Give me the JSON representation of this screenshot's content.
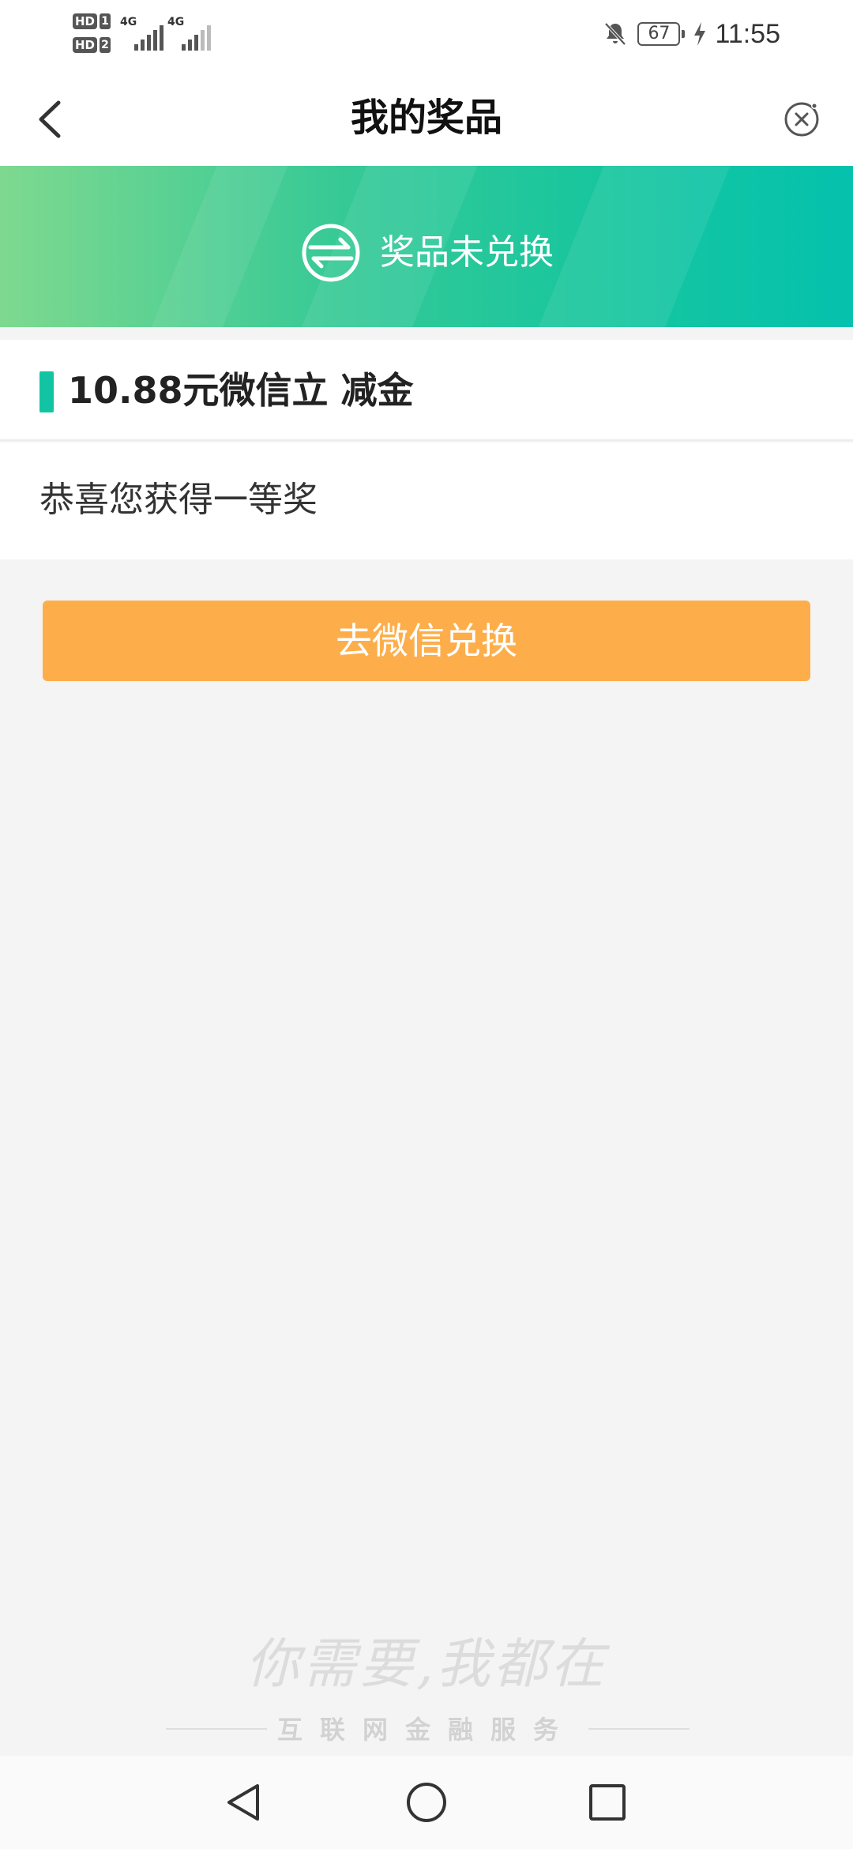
{
  "status_bar": {
    "sim1_label": "HD",
    "sim1_num": "1",
    "sim2_label": "HD",
    "sim2_num": "2",
    "net1": "4G",
    "net2": "4G",
    "battery": "67",
    "time": "11:55"
  },
  "header": {
    "title": "我的奖品",
    "back_icon": "chevron-left-icon",
    "close_icon": "close-circle-icon"
  },
  "banner": {
    "icon": "exchange-icon",
    "status_text": "奖品未兑换",
    "colors": {
      "start": "#7ed98f",
      "end": "#04c2ad"
    }
  },
  "prize": {
    "name": "10.88元微信立 减金",
    "description": "恭喜您获得一等奖",
    "accent_color": "#12c4a4"
  },
  "action": {
    "redeem_label": "去微信兑换",
    "button_color": "#fdae4b"
  },
  "footer_slogan": {
    "script_text": "你需要,我都在",
    "subtitle": "互联网金融服务"
  },
  "nav": {
    "back_icon": "nav-back-triangle-icon",
    "home_icon": "nav-home-circle-icon",
    "recents_icon": "nav-recents-square-icon"
  }
}
